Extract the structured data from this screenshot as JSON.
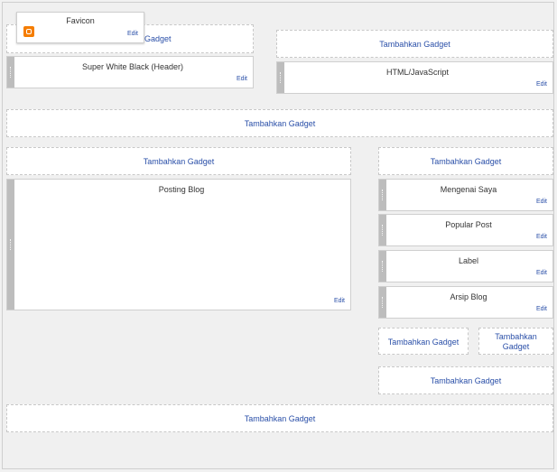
{
  "labels": {
    "add_gadget": "Tambahkan Gadget",
    "add_gadget_line1": "Tambahkan",
    "add_gadget_line2": "Gadget",
    "add_gadget_partial": "Gadget",
    "edit": "Edit"
  },
  "favicon": {
    "title": "Favicon",
    "icon": "blogger-icon",
    "icon_color": "#f57d00"
  },
  "widgets": {
    "header": "Super White Black (Header)",
    "html_js": "HTML/JavaScript",
    "posting_blog": "Posting Blog",
    "mengenai_saya": "Mengenai Saya",
    "popular_post": "Popular Post",
    "label": "Label",
    "arsip_blog": "Arsip Blog"
  },
  "colors": {
    "link": "#2a4fa8",
    "handle": "#bdbdbd",
    "accent": "#f57d00"
  }
}
